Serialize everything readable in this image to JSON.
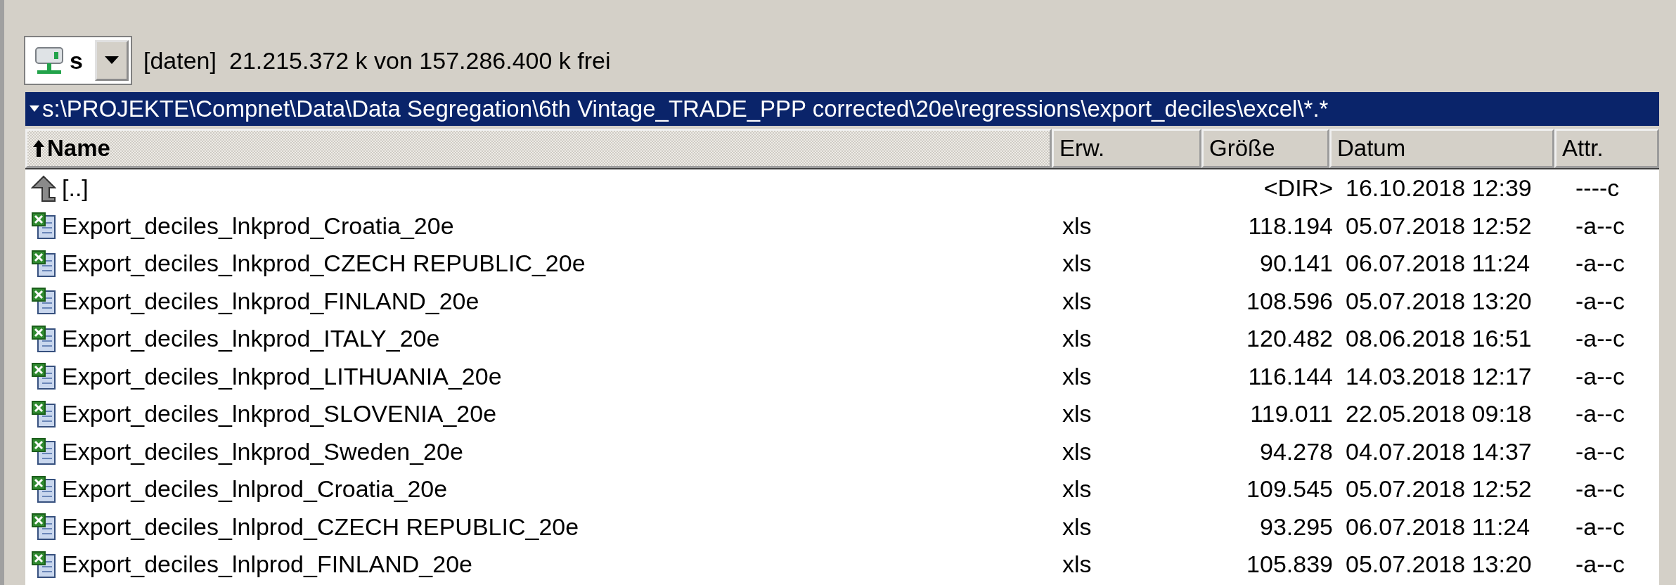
{
  "drive": {
    "letter": "s",
    "label": "[daten]",
    "free": "21.215.372 k von 157.286.400 k frei"
  },
  "path": "s:\\PROJEKTE\\Compnet\\Data\\Data Segregation\\6th Vintage_TRADE_PPP corrected\\20e\\regressions\\export_deciles\\excel\\*.*",
  "columns": [
    {
      "label": "Name",
      "sorted": true
    },
    {
      "label": "Erw.",
      "sorted": false
    },
    {
      "label": "Größe",
      "sorted": false
    },
    {
      "label": "Datum",
      "sorted": false
    },
    {
      "label": "Attr.",
      "sorted": false
    }
  ],
  "rows": [
    {
      "kind": "parent",
      "name": "[..]",
      "size": "<DIR>",
      "date": "16.10.2018 12:39",
      "attr": "----c"
    },
    {
      "kind": "excel",
      "name": "Export_deciles_lnkprod_Croatia_20e",
      "ext": "xls",
      "size": "118.194",
      "date": "05.07.2018 12:52",
      "attr": "-a--c"
    },
    {
      "kind": "excel",
      "name": "Export_deciles_lnkprod_CZECH REPUBLIC_20e",
      "ext": "xls",
      "size": "90.141",
      "date": "06.07.2018 11:24",
      "attr": "-a--c"
    },
    {
      "kind": "excel",
      "name": "Export_deciles_lnkprod_FINLAND_20e",
      "ext": "xls",
      "size": "108.596",
      "date": "05.07.2018 13:20",
      "attr": "-a--c"
    },
    {
      "kind": "excel",
      "name": "Export_deciles_lnkprod_ITALY_20e",
      "ext": "xls",
      "size": "120.482",
      "date": "08.06.2018 16:51",
      "attr": "-a--c"
    },
    {
      "kind": "excel",
      "name": "Export_deciles_lnkprod_LITHUANIA_20e",
      "ext": "xls",
      "size": "116.144",
      "date": "14.03.2018 12:17",
      "attr": "-a--c"
    },
    {
      "kind": "excel",
      "name": "Export_deciles_lnkprod_SLOVENIA_20e",
      "ext": "xls",
      "size": "119.011",
      "date": "22.05.2018 09:18",
      "attr": "-a--c"
    },
    {
      "kind": "excel",
      "name": "Export_deciles_lnkprod_Sweden_20e",
      "ext": "xls",
      "size": "94.278",
      "date": "04.07.2018 14:37",
      "attr": "-a--c"
    },
    {
      "kind": "excel",
      "name": "Export_deciles_lnlprod_Croatia_20e",
      "ext": "xls",
      "size": "109.545",
      "date": "05.07.2018 12:52",
      "attr": "-a--c"
    },
    {
      "kind": "excel",
      "name": "Export_deciles_lnlprod_CZECH REPUBLIC_20e",
      "ext": "xls",
      "size": "93.295",
      "date": "06.07.2018 11:24",
      "attr": "-a--c"
    },
    {
      "kind": "excel",
      "name": "Export_deciles_lnlprod_FINLAND_20e",
      "ext": "xls",
      "size": "105.839",
      "date": "05.07.2018 13:20",
      "attr": "-a--c"
    }
  ]
}
